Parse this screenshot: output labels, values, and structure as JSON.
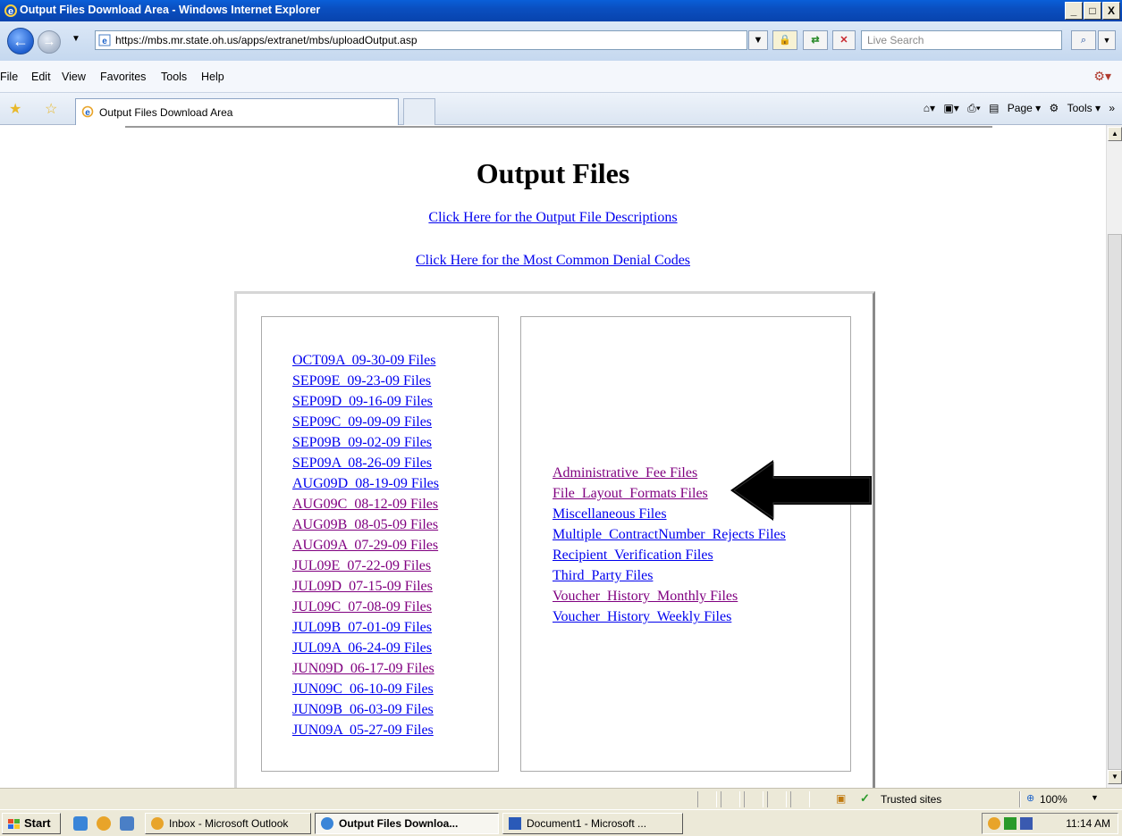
{
  "window": {
    "title": "Output Files Download Area - Windows Internet Explorer",
    "min": "_",
    "max": "□",
    "close": "X"
  },
  "address": {
    "url": "https://mbs.mr.state.oh.us/apps/extranet/mbs/uploadOutput.asp",
    "search_placeholder": "Live Search"
  },
  "menu": [
    "File",
    "Edit",
    "View",
    "Favorites",
    "Tools",
    "Help"
  ],
  "tab": {
    "title": "Output Files Download Area"
  },
  "toolbar": {
    "page_label": "Page",
    "tools_label": "Tools"
  },
  "page": {
    "title": "Output Files",
    "link_descriptions": "Click Here for the Output File Descriptions",
    "link_denial_codes": "Click Here for the Most Common Denial Codes",
    "left_links": [
      {
        "label": "OCT09A  09-30-09 Files",
        "visited": false
      },
      {
        "label": "SEP09E  09-23-09 Files",
        "visited": false
      },
      {
        "label": "SEP09D  09-16-09 Files",
        "visited": false
      },
      {
        "label": "SEP09C  09-09-09 Files",
        "visited": false
      },
      {
        "label": "SEP09B  09-02-09 Files",
        "visited": false
      },
      {
        "label": "SEP09A  08-26-09 Files",
        "visited": false
      },
      {
        "label": "AUG09D  08-19-09 Files",
        "visited": false
      },
      {
        "label": "AUG09C  08-12-09 Files",
        "visited": true
      },
      {
        "label": "AUG09B  08-05-09 Files",
        "visited": true
      },
      {
        "label": "AUG09A  07-29-09 Files",
        "visited": true
      },
      {
        "label": "JUL09E  07-22-09 Files",
        "visited": true
      },
      {
        "label": "JUL09D  07-15-09 Files",
        "visited": true
      },
      {
        "label": "JUL09C  07-08-09 Files",
        "visited": true
      },
      {
        "label": "JUL09B  07-01-09 Files",
        "visited": false
      },
      {
        "label": "JUL09A  06-24-09 Files",
        "visited": false
      },
      {
        "label": "JUN09D  06-17-09 Files",
        "visited": true
      },
      {
        "label": "JUN09C  06-10-09 Files",
        "visited": false
      },
      {
        "label": "JUN09B  06-03-09 Files",
        "visited": false
      },
      {
        "label": "JUN09A  05-27-09 Files",
        "visited": false
      }
    ],
    "right_links": [
      {
        "label": "Administrative  Fee Files",
        "visited": true
      },
      {
        "label": "File  Layout  Formats Files",
        "visited": true
      },
      {
        "label": "Miscellaneous Files",
        "visited": false
      },
      {
        "label": "Multiple  ContractNumber  Rejects Files",
        "visited": false
      },
      {
        "label": "Recipient  Verification Files",
        "visited": false
      },
      {
        "label": "Third  Party Files",
        "visited": false
      },
      {
        "label": "Voucher  History  Monthly Files",
        "visited": true
      },
      {
        "label": "Voucher  History  Weekly Files",
        "visited": false
      }
    ]
  },
  "status": {
    "zone": "Trusted sites",
    "zoom": "100%"
  },
  "taskbar": {
    "start": "Start",
    "items": [
      "Inbox - Microsoft Outlook",
      "Output Files Downloa...",
      "Document1 - Microsoft ..."
    ],
    "clock": "11:14 AM"
  },
  "colors": {
    "link": "#0000ee",
    "visited": "#800080",
    "titlebar": "#0a4fc0"
  }
}
